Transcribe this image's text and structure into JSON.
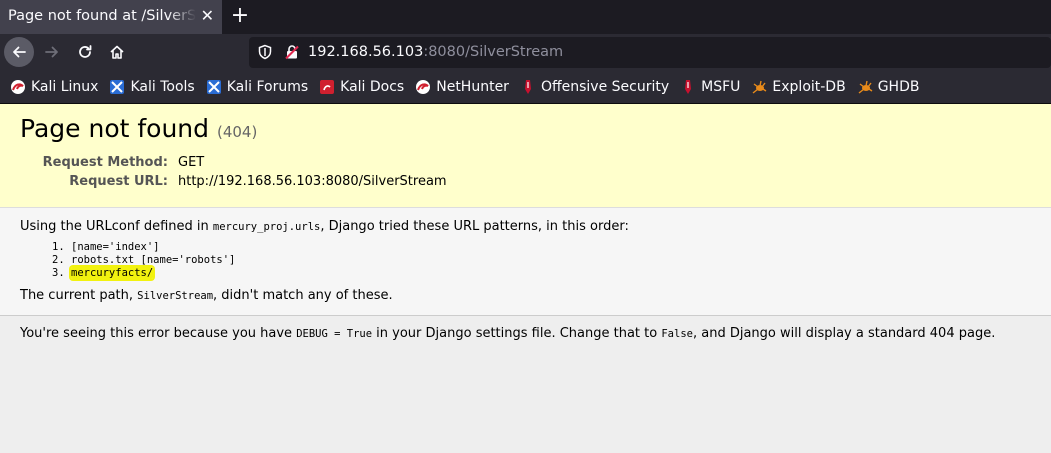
{
  "tab": {
    "title": "Page not found at /SilverStream",
    "close": "✕",
    "new_tab": "+"
  },
  "navbar": {
    "url_host": "192.168.56.103",
    "url_rest": ":8080/SilverStream"
  },
  "bookmarks": [
    {
      "label": "Kali Linux",
      "icon": "kali-icon"
    },
    {
      "label": "Kali Tools",
      "icon": "kali-tools-icon"
    },
    {
      "label": "Kali Forums",
      "icon": "kali-forums-icon"
    },
    {
      "label": "Kali Docs",
      "icon": "kali-docs-icon"
    },
    {
      "label": "NetHunter",
      "icon": "kali-icon"
    },
    {
      "label": "Offensive Security",
      "icon": "offsec-icon"
    },
    {
      "label": "MSFU",
      "icon": "offsec-icon"
    },
    {
      "label": "Exploit-DB",
      "icon": "exploitdb-icon"
    },
    {
      "label": "GHDB",
      "icon": "exploitdb-icon"
    }
  ],
  "page": {
    "title": "Page not found",
    "status": "(404)",
    "request_method_label": "Request Method:",
    "request_method": "GET",
    "request_url_label": "Request URL:",
    "request_url": "http://192.168.56.103:8080/SilverStream",
    "urlconf_pre": "Using the URLconf defined in ",
    "urlconf_module": "mercury_proj.urls",
    "urlconf_post": ", Django tried these URL patterns, in this order:",
    "patterns": [
      "[name='index']",
      "robots.txt [name='robots']",
      "mercuryfacts/"
    ],
    "path_pre": "The current path, ",
    "path": "SilverStream",
    "path_post": ", didn't match any of these.",
    "debug_1": "You're seeing this error because you have ",
    "debug_code": "DEBUG = True",
    "debug_2": " in your Django settings file. Change that to ",
    "debug_false": "False",
    "debug_3": ", and Django will display a standard 404 page.",
    "highlight_color": "#f2f20f"
  }
}
